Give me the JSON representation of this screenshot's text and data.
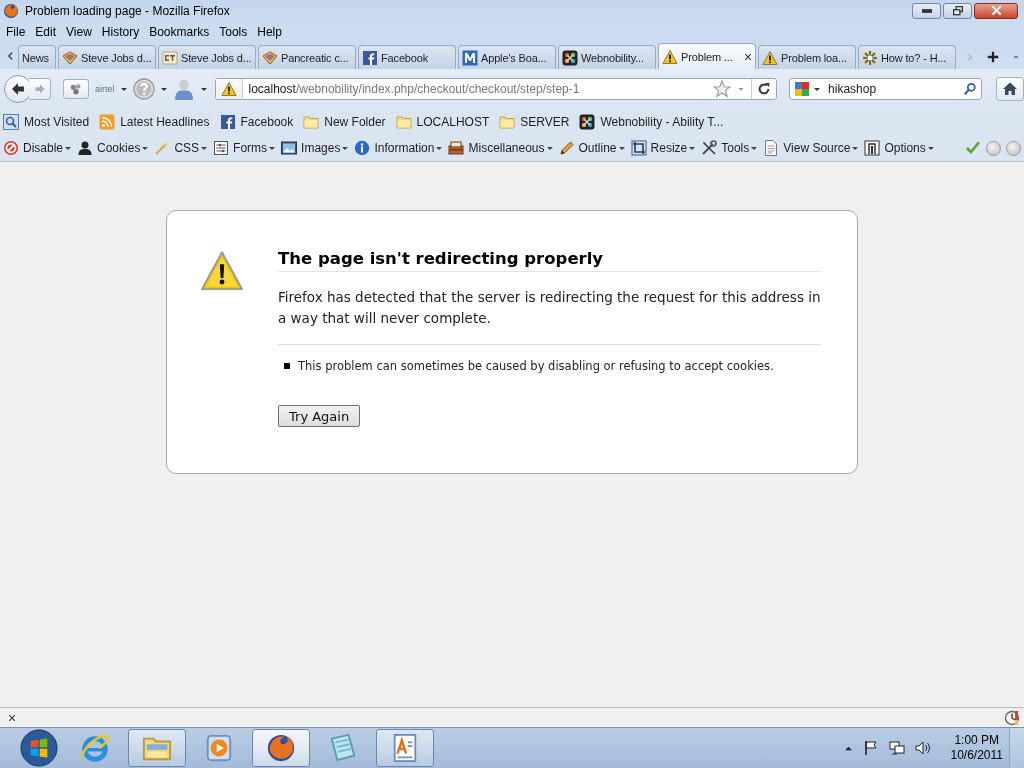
{
  "window": {
    "title": "Problem loading page - Mozilla Firefox"
  },
  "menu": [
    {
      "label": "File"
    },
    {
      "label": "Edit"
    },
    {
      "label": "View"
    },
    {
      "label": "History"
    },
    {
      "label": "Bookmarks"
    },
    {
      "label": "Tools"
    },
    {
      "label": "Help"
    }
  ],
  "tabs": [
    {
      "label": "News",
      "kind": "none",
      "selected": false
    },
    {
      "label": "Steve Jobs d...",
      "kind": "book",
      "selected": false
    },
    {
      "label": "Steve Jobs d...",
      "kind": "et",
      "selected": false
    },
    {
      "label": "Pancreatic c...",
      "kind": "book",
      "selected": false
    },
    {
      "label": "Facebook",
      "kind": "facebook",
      "selected": false
    },
    {
      "label": "Apple's Boa...",
      "kind": "m",
      "selected": false
    },
    {
      "label": "Webnobility...",
      "kind": "joomla",
      "selected": false
    },
    {
      "label": "Problem ...",
      "kind": "warning",
      "selected": true,
      "close": "×"
    },
    {
      "label": "Problem loa...",
      "kind": "warning",
      "selected": false
    },
    {
      "label": "How to? - H...",
      "kind": "burst",
      "selected": false
    }
  ],
  "navigation": {
    "addon_label": "airtel",
    "url_host": "localhost",
    "url_path": "/webnobility/index.php/checkout/checkout/step/step-1",
    "search_value": "hikashop"
  },
  "bookmarks": [
    {
      "label": "Most Visited",
      "kind": "most-visited"
    },
    {
      "label": "Latest Headlines",
      "kind": "rss"
    },
    {
      "label": "Facebook",
      "kind": "facebook"
    },
    {
      "label": "New Folder",
      "kind": "folder"
    },
    {
      "label": "LOCALHOST",
      "kind": "folder"
    },
    {
      "label": "SERVER",
      "kind": "folder"
    },
    {
      "label": "Webnobility - Ability T...",
      "kind": "joomla"
    }
  ],
  "dev_toolbar": [
    {
      "label": "Disable",
      "kind": "disable"
    },
    {
      "label": "Cookies",
      "kind": "cookies"
    },
    {
      "label": "CSS",
      "kind": "css"
    },
    {
      "label": "Forms",
      "kind": "forms"
    },
    {
      "label": "Images",
      "kind": "images"
    },
    {
      "label": "Information",
      "kind": "information"
    },
    {
      "label": "Miscellaneous",
      "kind": "misc"
    },
    {
      "label": "Outline",
      "kind": "outline"
    },
    {
      "label": "Resize",
      "kind": "resize"
    },
    {
      "label": "Tools",
      "kind": "tools"
    },
    {
      "label": "View Source",
      "kind": "source"
    },
    {
      "label": "Options",
      "kind": "options"
    }
  ],
  "error_page": {
    "heading": "The page isn't redirecting properly",
    "description": "Firefox has detected that the server is redirecting the request for this address in a way that will never complete.",
    "bullets": [
      "This problem can sometimes be caused by disabling or refusing to accept cookies."
    ],
    "button": "Try Again"
  },
  "status_bar": {
    "close": "×"
  },
  "taskbar": {
    "apps": [
      {
        "kind": "ie",
        "open": false,
        "selected": false
      },
      {
        "kind": "explorer",
        "open": true,
        "selected": false
      },
      {
        "kind": "media",
        "open": false,
        "selected": false
      },
      {
        "kind": "firefox",
        "open": true,
        "selected": true
      },
      {
        "kind": "notes",
        "open": false,
        "selected": false
      },
      {
        "kind": "wordpad",
        "open": true,
        "selected": false
      }
    ],
    "time": "1:00 PM",
    "date": "10/6/2011"
  }
}
